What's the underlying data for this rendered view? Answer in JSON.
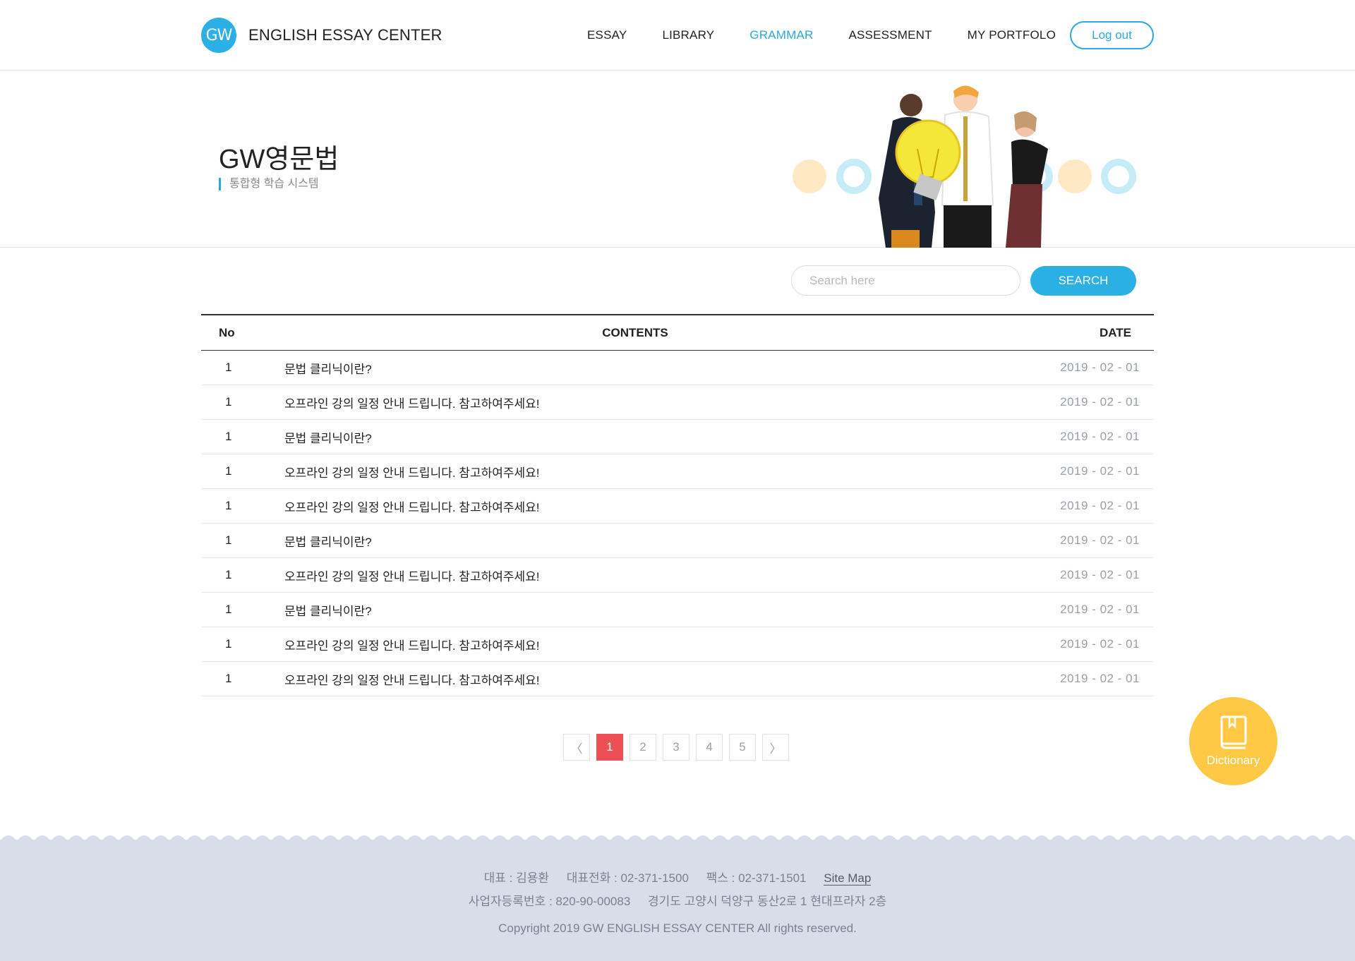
{
  "header": {
    "logo_mark": "GW",
    "logo_text": "ENGLISH ESSAY CENTER",
    "nav": [
      {
        "label": "ESSAY",
        "active": false
      },
      {
        "label": "LIBRARY",
        "active": false
      },
      {
        "label": "GRAMMAR",
        "active": true
      },
      {
        "label": "ASSESSMENT",
        "active": false
      },
      {
        "label": "MY PORTFOLO",
        "active": false
      }
    ],
    "logout_label": "Log out"
  },
  "hero": {
    "title": "GW영문법",
    "subtitle": "통합형 학습 시스템"
  },
  "search": {
    "placeholder": "Search here",
    "button_label": "SEARCH"
  },
  "table": {
    "headers": {
      "no": "No",
      "contents": "CONTENTS",
      "date": "DATE"
    },
    "rows": [
      {
        "no": "1",
        "contents": "문법 클리닉이란?",
        "date": "2019 - 02 - 01"
      },
      {
        "no": "1",
        "contents": "오프라인 강의 일정 안내 드립니다. 참고하여주세요!",
        "date": "2019 - 02 - 01"
      },
      {
        "no": "1",
        "contents": "문법 클리닉이란?",
        "date": "2019 - 02 - 01"
      },
      {
        "no": "1",
        "contents": "오프라인 강의 일정 안내 드립니다. 참고하여주세요!",
        "date": "2019 - 02 - 01"
      },
      {
        "no": "1",
        "contents": "오프라인 강의 일정 안내 드립니다. 참고하여주세요!",
        "date": "2019 - 02 - 01"
      },
      {
        "no": "1",
        "contents": "문법 클리닉이란?",
        "date": "2019 - 02 - 01"
      },
      {
        "no": "1",
        "contents": "오프라인 강의 일정 안내 드립니다. 참고하여주세요!",
        "date": "2019 - 02 - 01"
      },
      {
        "no": "1",
        "contents": "문법 클리닉이란?",
        "date": "2019 - 02 - 01"
      },
      {
        "no": "1",
        "contents": "오프라인 강의 일정 안내 드립니다. 참고하여주세요!",
        "date": "2019 - 02 - 01"
      },
      {
        "no": "1",
        "contents": "오프라인 강의 일정 안내 드립니다. 참고하여주세요!",
        "date": "2019 - 02 - 01"
      }
    ]
  },
  "pagination": {
    "prev": "〈",
    "pages": [
      "1",
      "2",
      "3",
      "4",
      "5"
    ],
    "current": "1",
    "next": "〉"
  },
  "dictionary": {
    "label": "Dictionary",
    "icon": "book-icon"
  },
  "footer": {
    "ceo": "대표 : 김용환",
    "phone": "대표전화 : 02-371-1500",
    "fax": "팩스 : 02-371-1501",
    "sitemap": "Site Map",
    "business_no": "사업자등록번호 : 820-90-00083",
    "address": "경기도 고양시 덕양구 동산2로 1 현대프라자 2층",
    "copyright": "Copyright 2019 GW ENGLISH ESSAY CENTER All rights reserved."
  },
  "colors": {
    "accent": "#2bb0e6",
    "active_page": "#ee4f56",
    "dictionary": "#ffc845",
    "footer_bg": "#d8dee9"
  }
}
